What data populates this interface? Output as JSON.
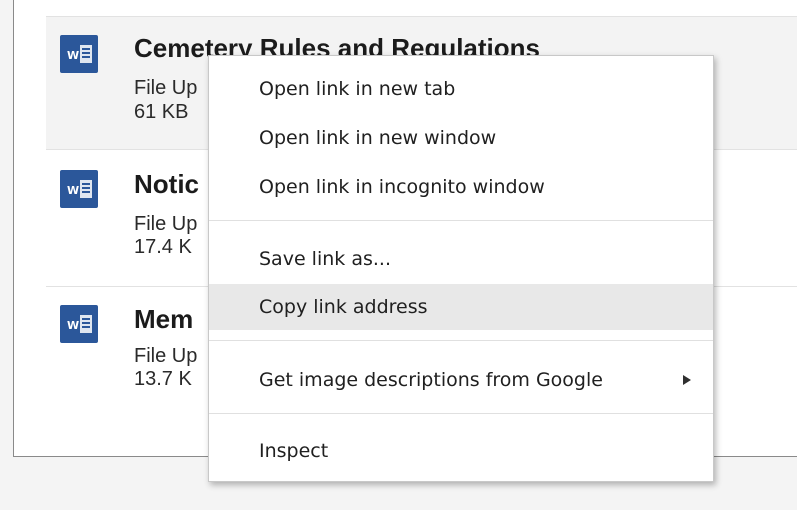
{
  "files": [
    {
      "title": "Cemetery Rules and Regulations",
      "meta_line_1": "File Up",
      "meta_line_2": "61 KB",
      "icon": "word-document-icon"
    },
    {
      "title": "Notic",
      "meta_line_1": "File Up",
      "meta_line_2": "17.4 K",
      "icon": "word-document-icon"
    },
    {
      "title": "Mem",
      "meta_line_1": "File Up",
      "meta_line_2": "13.7 K",
      "icon": "word-document-icon"
    }
  ],
  "context_menu": {
    "open_new_tab": "Open link in new tab",
    "open_new_window": "Open link in new window",
    "open_incognito": "Open link in incognito window",
    "save_link_as": "Save link as...",
    "copy_link_address": "Copy link address",
    "get_image_descriptions": "Get image descriptions from Google",
    "inspect": "Inspect",
    "submenu_icon": "chevron-right-icon",
    "highlighted_item": "Copy link address"
  },
  "colors": {
    "word_blue": "#2b579a",
    "menu_highlight": "#e8e8e8",
    "hover_row": "#f3f3f3"
  }
}
